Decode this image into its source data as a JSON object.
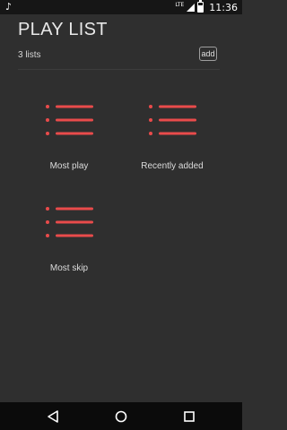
{
  "status_bar": {
    "time": "11:36",
    "network": "LTE",
    "icons": [
      "music-note-icon",
      "signal-icon",
      "battery-icon"
    ]
  },
  "header": {
    "title": "PLAY LIST",
    "count": "3 lists",
    "add_label": "add"
  },
  "playlists": [
    {
      "label": "Most play",
      "icon": "playlist-icon"
    },
    {
      "label": "Recently added",
      "icon": "playlist-icon"
    },
    {
      "label": "Most skip",
      "icon": "playlist-icon"
    }
  ],
  "nav_bar": {
    "buttons": [
      "back-icon",
      "home-icon",
      "recents-icon"
    ]
  },
  "colors": {
    "background": "#2f2f2f",
    "accent": "#e94b4b",
    "status_bar": "#161616",
    "nav_bar": "#0b0b0b"
  }
}
